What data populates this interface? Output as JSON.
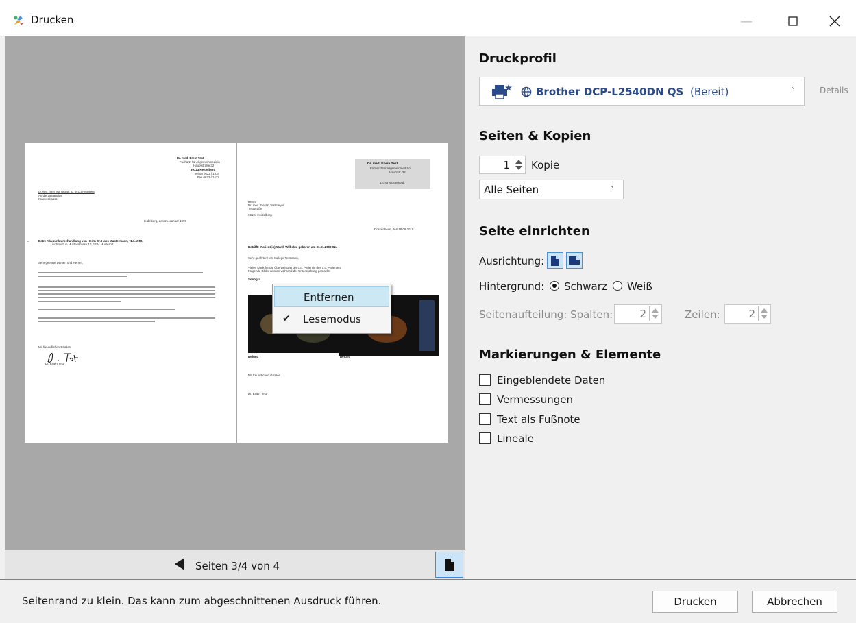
{
  "window": {
    "title": "Drucken"
  },
  "preview": {
    "page1": {
      "letterhead": [
        "Dr. med. Erein Test",
        "Facharzt für Allgemeinmedizin",
        "Hauptstraße 32",
        "69123 Heidelberg",
        "Tel.0a 0622 / 1234",
        "Fax 0622 / 1423"
      ],
      "sender_line": "Dr. med. Erwin Test, Hausstr. 32, 69123 Heidelberg",
      "recipient": [
        "An die zuständige",
        "Krankenkasse"
      ],
      "date": "Heidelberg, den 21. Januar 1997",
      "subject": "Betr.: Akupunkturbehandlung von Herrn Dr. Hans Mustermann, *1.1.1950,",
      "subject2": "wohnhaft in Musterstrasse 10, 1234 Musterort",
      "salutation": "Sehr geehrte Damen und Herren,",
      "closing": "Mit freundlichen Grüßen",
      "signer": "Dr. Erwin Test"
    },
    "page2": {
      "letterhead": [
        "Dr. med. Erwin Test",
        "Facharzt für Allgemeinmedizin",
        "Hauptstr. 32",
        "12345 Musterstadt"
      ],
      "recipient": [
        "Herrn",
        "Dr. med. Gerald Testmeyer",
        "Teststraße",
        "69124 Heidelberg"
      ],
      "date": "Dossenheim, den 18.09.2019",
      "subject": "Betrifft:  Patient(in) Ward, Wilhelm, geboren am 01.01.2000 Sz.",
      "salutation": "Sehr geehrter Herr Kollege Testmann,",
      "body": [
        "Vielen Dank für die Überweisung der o.g. Patientin des o.g. Patienten.",
        "Folgende Bilder wurden während der Untersuchung gemacht:"
      ],
      "section": "Sonogra",
      "img_label_left": "Befund",
      "img_label_right": "Befund",
      "closing": "Mit freundlichen Grüßen",
      "signer": "Dr. Erwin Test"
    },
    "context_menu": {
      "items": [
        {
          "label": "Entfernen",
          "checked": false
        },
        {
          "label": "Lesemodus",
          "checked": true
        }
      ]
    },
    "nav": {
      "page_info": "Seiten 3/4 von 4"
    }
  },
  "panel": {
    "printer_profile": {
      "heading": "Druckprofil",
      "printer_name": "Brother DCP-L2540DN QS",
      "printer_state": "(Bereit)",
      "details_link": "Details"
    },
    "pages_copies": {
      "heading": "Seiten & Kopien",
      "copies_value": "1",
      "copies_label": "Kopie",
      "range_value": "Alle Seiten"
    },
    "page_setup": {
      "heading": "Seite einrichten",
      "orientation_label": "Ausrichtung:",
      "background_label": "Hintergrund:",
      "background_options": [
        "Schwarz",
        "Weiß"
      ],
      "background_selected": "Schwarz",
      "split_label": "Seitenaufteilung: Spalten:",
      "columns_value": "2",
      "rows_label": "Zeilen:",
      "rows_value": "2"
    },
    "marks": {
      "heading": "Markierungen & Elemente",
      "options": [
        {
          "label": "Eingeblendete Daten",
          "checked": false
        },
        {
          "label": "Vermessungen",
          "checked": false
        },
        {
          "label": "Text als Fußnote",
          "checked": false
        },
        {
          "label": "Lineale",
          "checked": false
        }
      ]
    }
  },
  "status": {
    "message": "Seitenrand zu klein.  Das kann zum abgeschnittenen Ausdruck führen.",
    "print_button": "Drucken",
    "cancel_button": "Abbrechen"
  },
  "colors": {
    "accent": "#3a8ee6",
    "printer_text": "#2b4a8a",
    "preview_bg": "#a8a8a8"
  }
}
